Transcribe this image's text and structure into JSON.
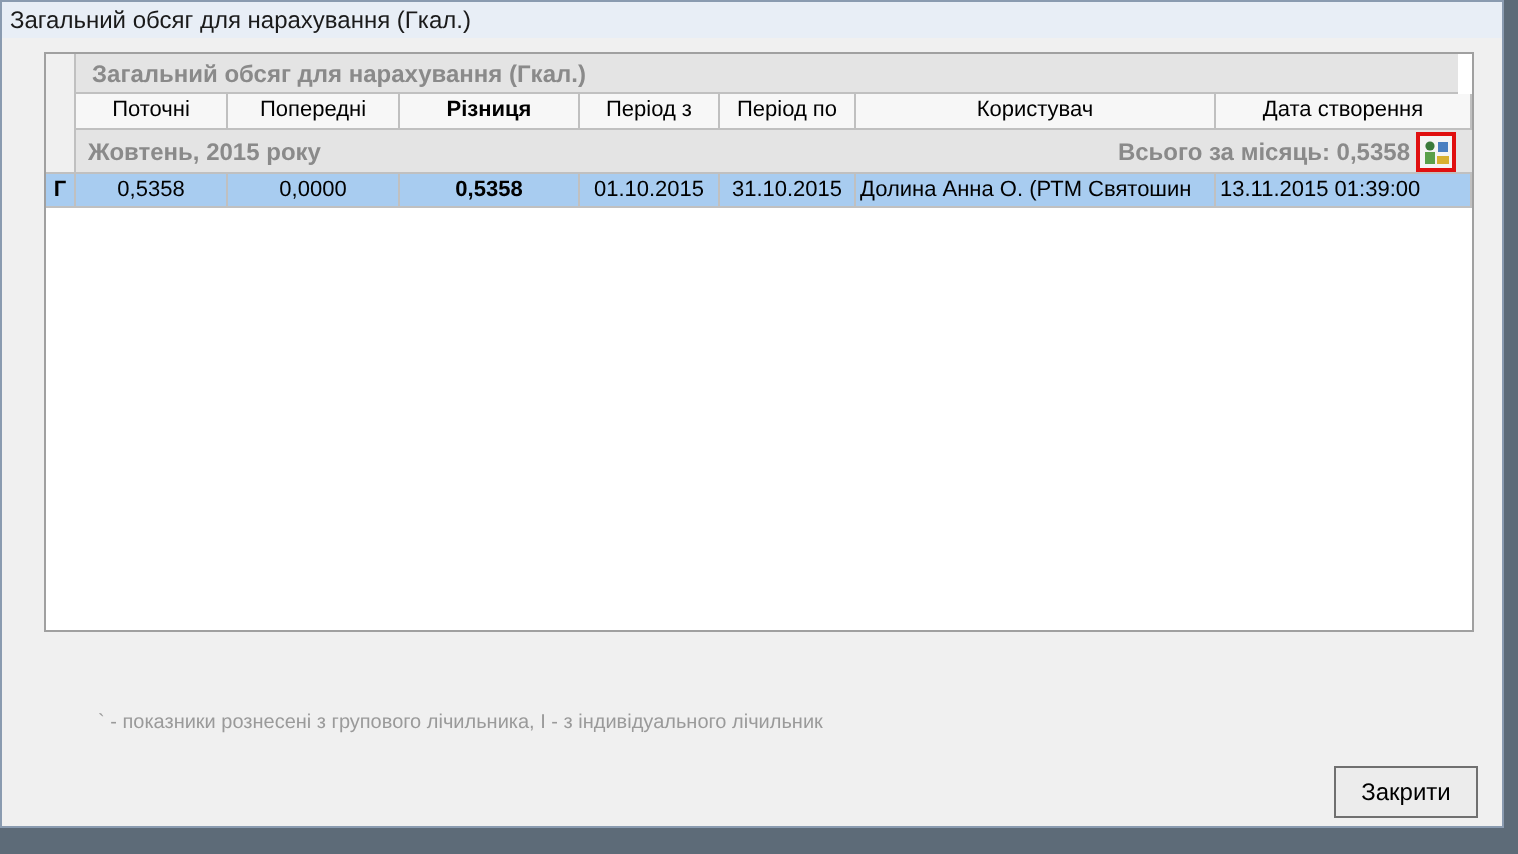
{
  "window": {
    "title": "Загальний обсяг для нарахування (Гкал.)"
  },
  "table": {
    "caption": "Загальний обсяг для нарахування (Гкал.)",
    "columns": [
      {
        "label": "Поточні",
        "bold": false
      },
      {
        "label": "Попередні",
        "bold": false
      },
      {
        "label": "Різниця",
        "bold": true
      },
      {
        "label": "Період з",
        "bold": false
      },
      {
        "label": "Період по",
        "bold": false
      },
      {
        "label": "Користувач",
        "bold": false
      },
      {
        "label": "Дата створення",
        "bold": false
      }
    ],
    "groups": [
      {
        "title": "Жовтень, 2015 року",
        "total": "Всього за місяць: 0,5358",
        "rows": [
          {
            "marker": "Г",
            "selected": true,
            "cells": [
              "0,5358",
              "0,0000",
              "0,5358",
              "01.10.2015",
              "31.10.2015",
              "Долина Анна О. (РТМ Святошин",
              "13.11.2015 01:39:00"
            ]
          }
        ]
      }
    ]
  },
  "footnote": "` - показники рознесені з групового лічильника, І - з індивідуального лічильник",
  "buttons": [
    {
      "label": "Закрити"
    }
  ]
}
